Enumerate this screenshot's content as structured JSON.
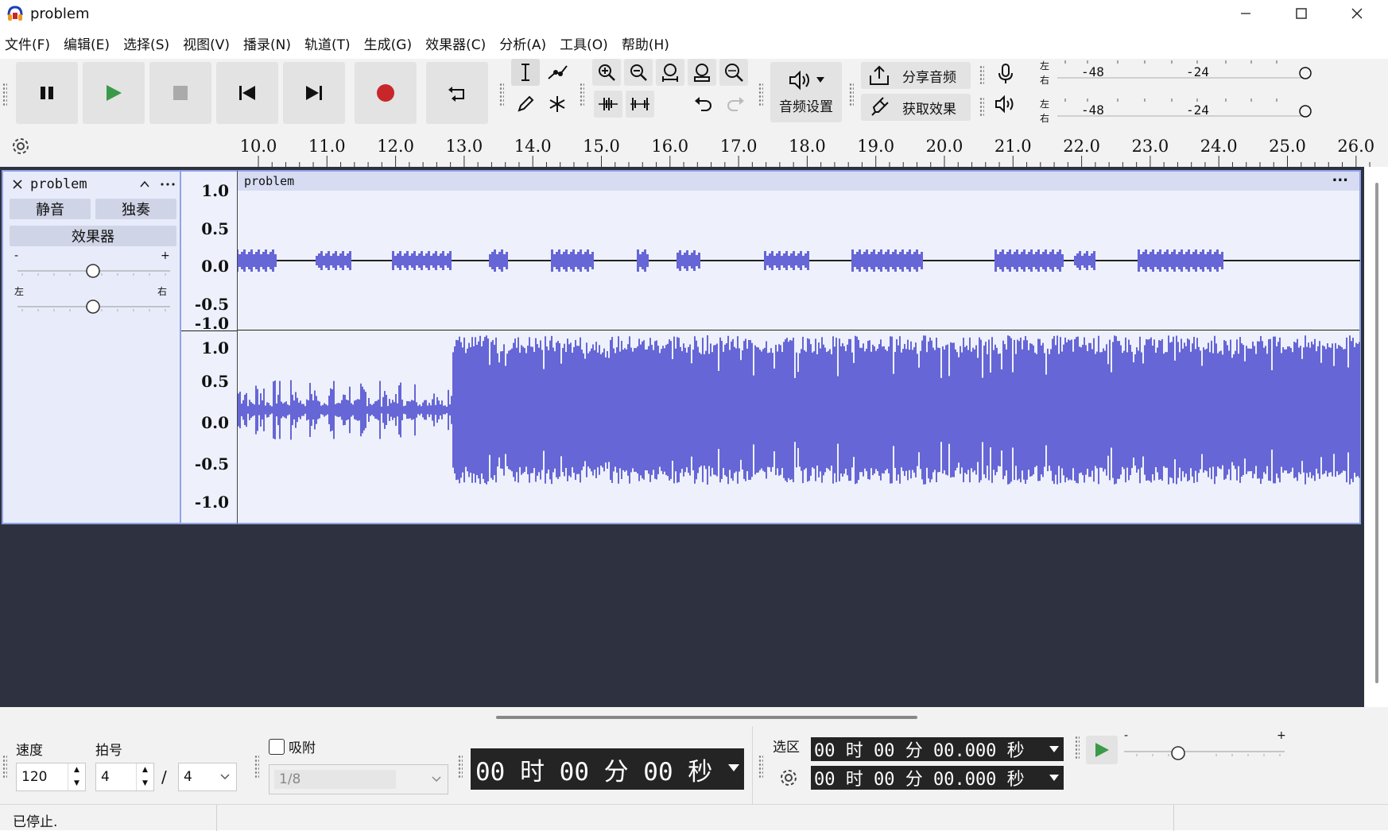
{
  "window": {
    "title": "problem"
  },
  "menu": [
    "文件(F)",
    "编辑(E)",
    "选择(S)",
    "视图(V)",
    "播录(N)",
    "轨道(T)",
    "生成(G)",
    "效果器(C)",
    "分析(A)",
    "工具(O)",
    "帮助(H)"
  ],
  "toolbar": {
    "audio_setup_label": "音频设置",
    "share_audio_label": "分享音频",
    "get_effects_label": "获取效果",
    "meter_left": "左",
    "meter_right": "右",
    "meter_ticks": [
      "-48",
      "-24"
    ]
  },
  "ruler": {
    "ticks": [
      "10.0",
      "11.0",
      "12.0",
      "13.0",
      "14.0",
      "15.0",
      "16.0",
      "17.0",
      "18.0",
      "19.0",
      "20.0",
      "21.0",
      "22.0",
      "23.0",
      "24.0",
      "25.0",
      "26.0"
    ]
  },
  "track": {
    "name": "problem",
    "mute_label": "静音",
    "solo_label": "独奏",
    "effects_label": "效果器",
    "gain_minus": "-",
    "gain_plus": "+",
    "pan_left": "左",
    "pan_right": "右",
    "clip_name": "problem",
    "clip_menu": "...",
    "vruler_top": [
      "1.0",
      "0.5",
      "0.0",
      "-0.5",
      "-1.0"
    ],
    "vruler_bottom": [
      "1.0",
      "0.5",
      "0.0",
      "-0.5",
      "-1.0"
    ]
  },
  "bottom": {
    "tempo_label": "速度",
    "tempo_value": "120",
    "timesig_label": "拍号",
    "timesig_num": "4",
    "timesig_sep": "/",
    "timesig_den": "4",
    "snap_label": "吸附",
    "snap_value": "1/8",
    "time_display": "00 时 00 分 00 秒",
    "selection_label": "选区",
    "sel_start": "00 时 00 分 00.000 秒",
    "sel_end": "00 时 00 分 00.000 秒",
    "play_speed_minus": "-",
    "play_speed_plus": "+"
  },
  "status": {
    "text": "已停止."
  },
  "colors": {
    "waveform": "#6666d6",
    "accent_play": "#3a9a4a",
    "record": "#c8262b",
    "track_bg": "#2e3140"
  }
}
